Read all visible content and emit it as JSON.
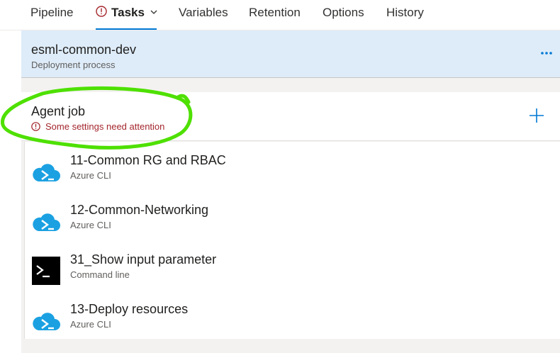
{
  "tabs": [
    {
      "label": "Pipeline"
    },
    {
      "label": "Tasks"
    },
    {
      "label": "Variables"
    },
    {
      "label": "Retention"
    },
    {
      "label": "Options"
    },
    {
      "label": "History"
    }
  ],
  "active_tab": "Tasks",
  "process": {
    "title": "esml-common-dev",
    "subtitle": "Deployment process"
  },
  "agent_job": {
    "title": "Agent job",
    "warning": "Some settings need attention"
  },
  "tasks": [
    {
      "title": "11-Common RG and RBAC",
      "subtitle": "Azure CLI",
      "icon": "azure-cli-icon"
    },
    {
      "title": "12-Common-Networking",
      "subtitle": "Azure CLI",
      "icon": "azure-cli-icon"
    },
    {
      "title": "31_Show input parameter",
      "subtitle": "Command line",
      "icon": "command-line-icon"
    },
    {
      "title": "13-Deploy resources",
      "subtitle": "Azure CLI",
      "icon": "azure-cli-icon"
    }
  ],
  "colors": {
    "accent": "#0078d4",
    "warning": "#a4262c",
    "header_bg": "#deecf9",
    "annotation": "#4ee000"
  }
}
